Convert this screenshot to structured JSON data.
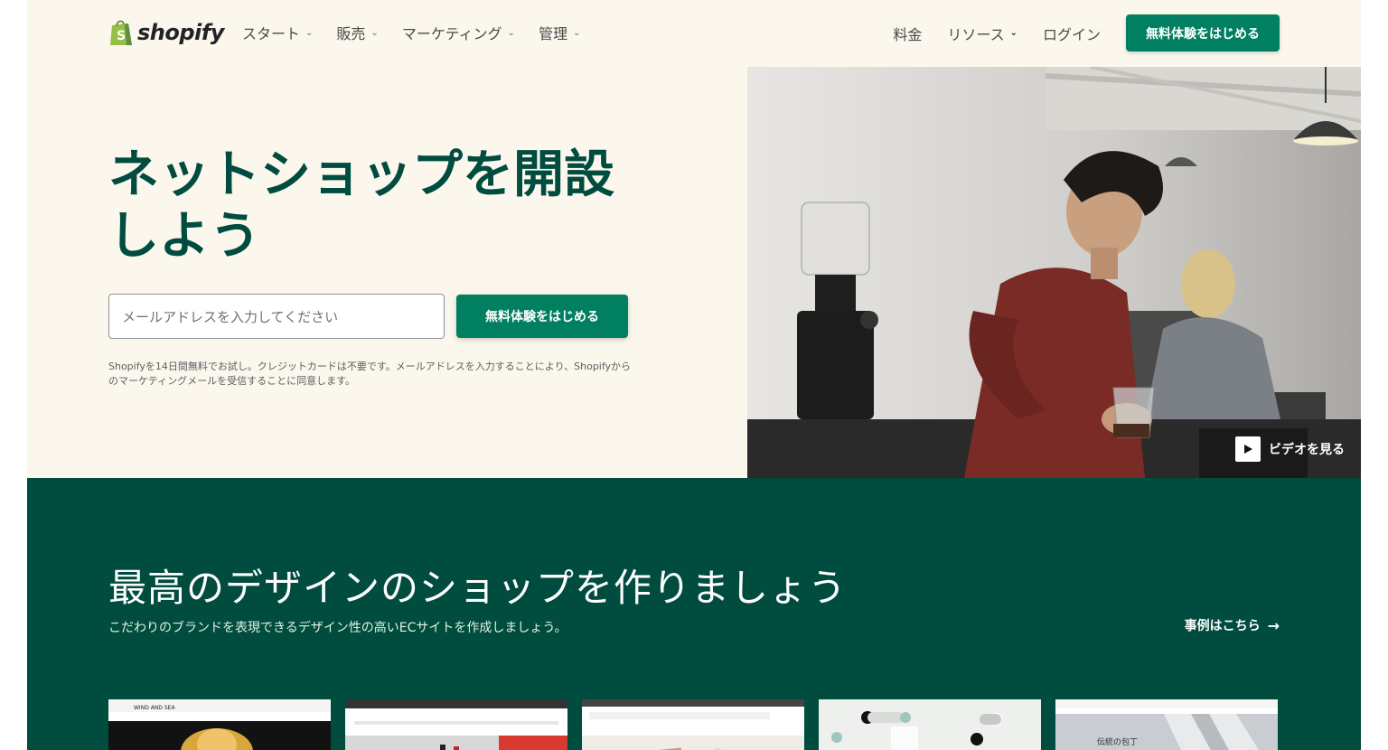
{
  "nav": {
    "brand": "shopify",
    "left_items": [
      {
        "label": "スタート"
      },
      {
        "label": "販売"
      },
      {
        "label": "マーケティング"
      },
      {
        "label": "管理"
      }
    ],
    "right_items": {
      "pricing": "料金",
      "resources": "リソース",
      "login": "ログイン"
    },
    "cta": "無料体験をはじめる"
  },
  "hero": {
    "headline_line1": "ネットショップを開設",
    "headline_line2": "しよう",
    "email_placeholder": "メールアドレスを入力してください",
    "cta": "無料体験をはじめる",
    "disclaimer": "Shopifyを14日間無料でお試し。クレジットカードは不要です。メールアドレスを入力することにより、Shopifyからのマーケティングメールを受信することに同意します。",
    "video_label": "ビデオを見る"
  },
  "design": {
    "title": "最高のデザインのショップを作りましょう",
    "subtitle": "こだわりのブランドを表現できるデザイン性の高いECサイトを作成しましょう。",
    "examples_link": "事例はこちら",
    "thumb_captions": {
      "thumb1": "WIND AND SEA",
      "thumb5": "伝統の包丁"
    }
  },
  "colors": {
    "brand_green": "#008060",
    "deep_green": "#004c3f",
    "hero_bg": "#fbf7ed"
  }
}
